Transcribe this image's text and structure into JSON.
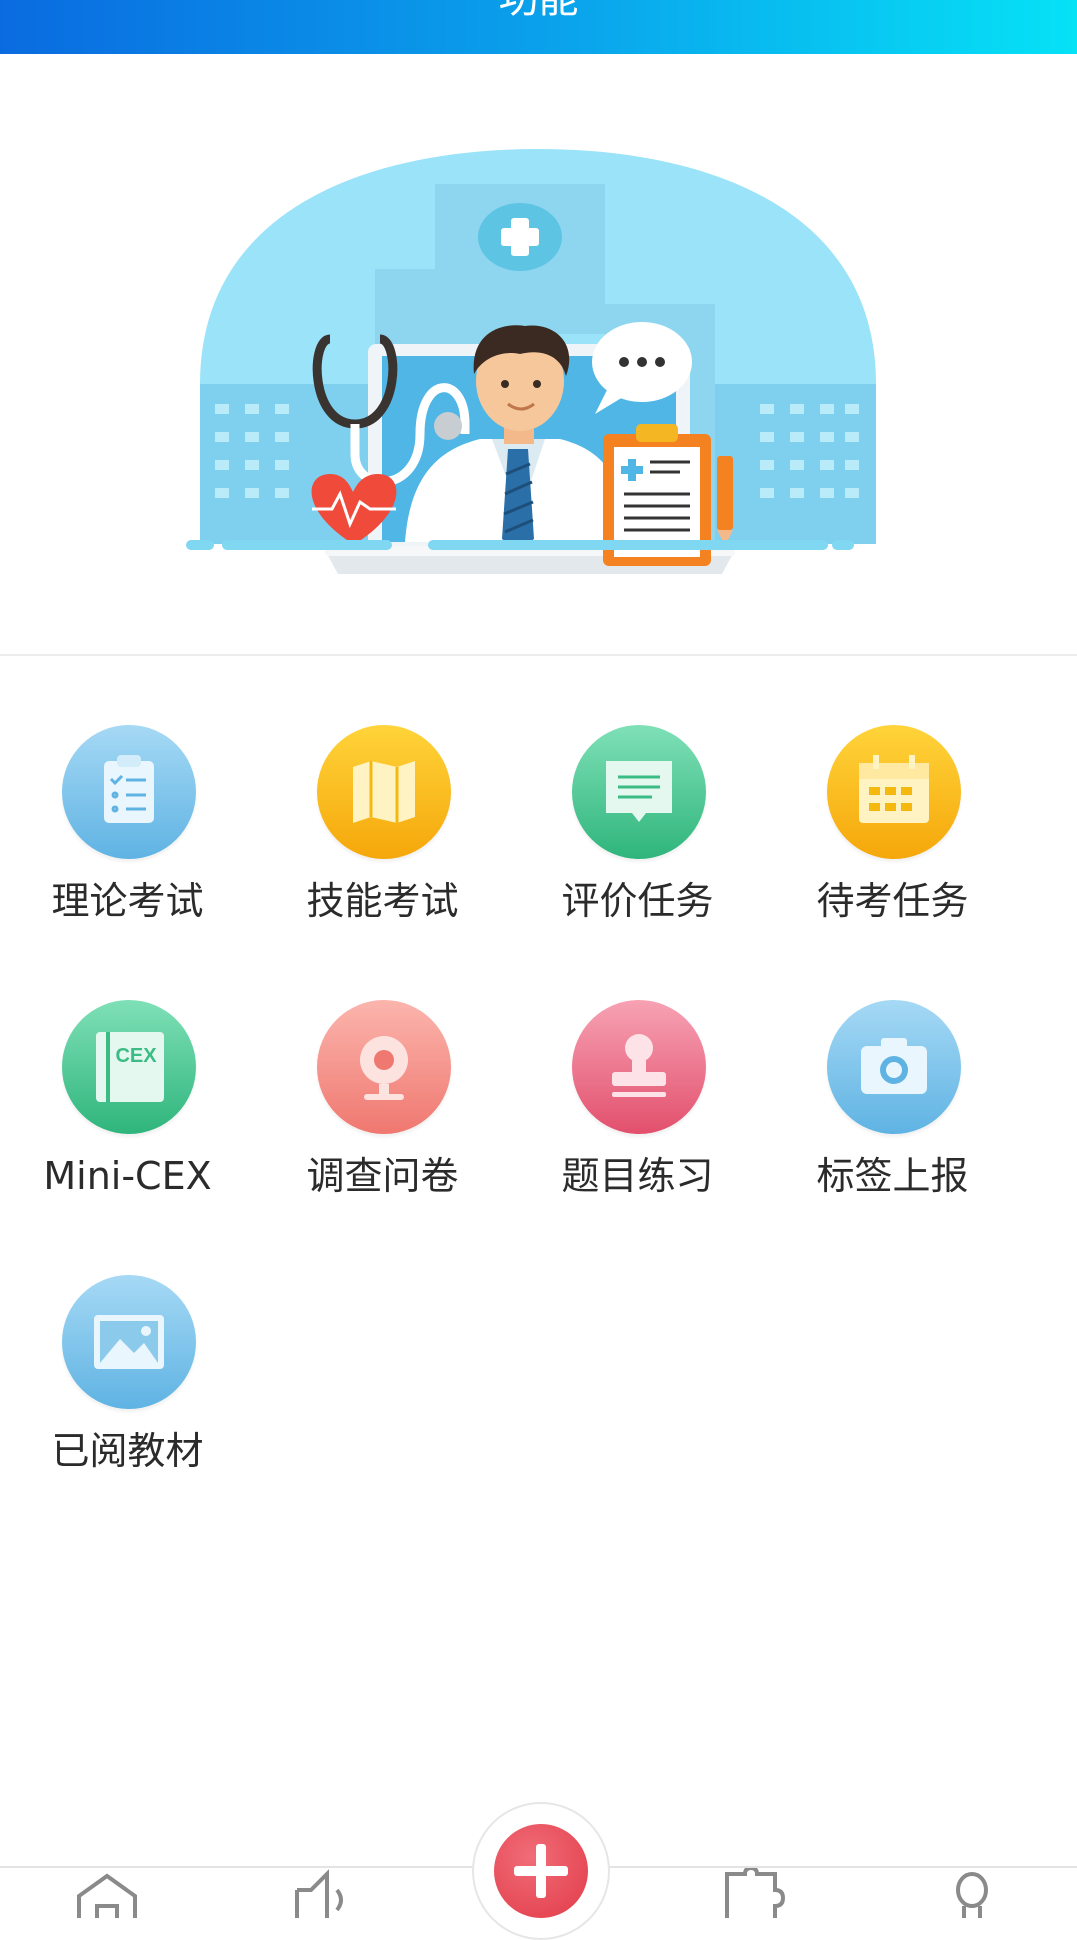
{
  "header": {
    "title": "功能"
  },
  "menu": [
    {
      "label": "理论考试",
      "icon": "clipboard-checklist-icon",
      "color_top": "#a6d9f5",
      "color_bottom": "#5fb3e3"
    },
    {
      "label": "技能考试",
      "icon": "map-icon",
      "color_top": "#ffd43a",
      "color_bottom": "#f5a70a"
    },
    {
      "label": "评价任务",
      "icon": "message-icon",
      "color_top": "#7fe0b7",
      "color_bottom": "#2fb57c"
    },
    {
      "label": "待考任务",
      "icon": "calendar-icon",
      "color_top": "#ffd43a",
      "color_bottom": "#f5a70a"
    },
    {
      "label": "Mini-CEX",
      "icon": "cex-book-icon",
      "color_top": "#7fe0b7",
      "color_bottom": "#2fb57c"
    },
    {
      "label": "调查问卷",
      "icon": "webcam-icon",
      "color_top": "#fbb5ad",
      "color_bottom": "#ef7870"
    },
    {
      "label": "题目练习",
      "icon": "stamp-icon",
      "color_top": "#f7a2b4",
      "color_bottom": "#e2506d"
    },
    {
      "label": "标签上报",
      "icon": "camera-icon",
      "color_top": "#a6d9f5",
      "color_bottom": "#5fb3e3"
    },
    {
      "label": "已阅教材",
      "icon": "image-icon",
      "color_top": "#a6d9f5",
      "color_bottom": "#5fb3e3"
    }
  ],
  "cex_text": "CEX",
  "tabbar": {
    "items": [
      {
        "icon": "home-icon"
      },
      {
        "icon": "speaker-icon"
      },
      {
        "icon": "add-icon"
      },
      {
        "icon": "puzzle-icon"
      },
      {
        "icon": "profile-icon"
      }
    ],
    "accent": "#e23a48"
  }
}
